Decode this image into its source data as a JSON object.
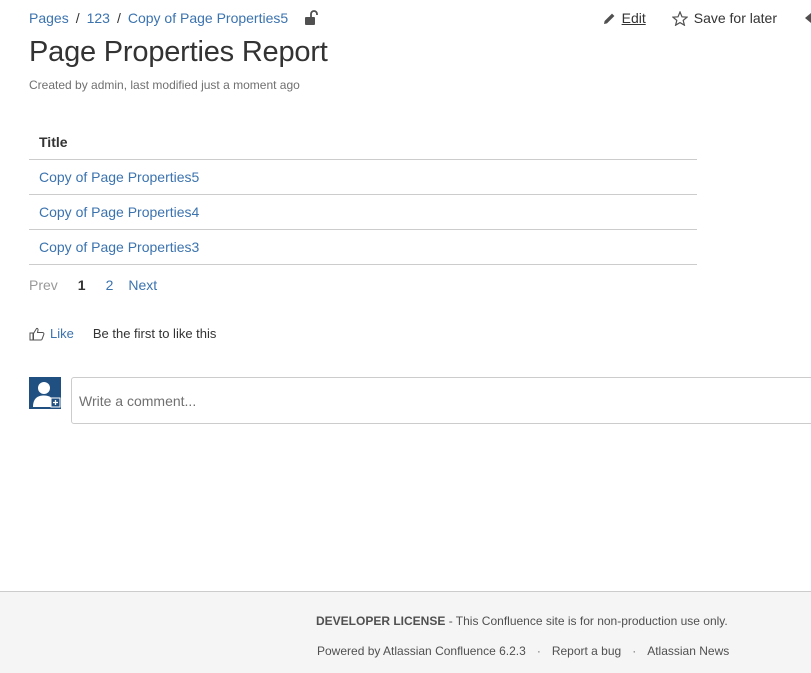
{
  "breadcrumb": {
    "items": [
      "Pages",
      "123",
      "Copy of Page Properties5"
    ],
    "separator": "/"
  },
  "actions": {
    "edit_label": "Edit",
    "save_label": "Save for later"
  },
  "page": {
    "title": "Page Properties Report",
    "byline": "Created by admin, last modified just a moment ago"
  },
  "report": {
    "header": "Title",
    "rows": [
      "Copy of Page Properties5",
      "Copy of Page Properties4",
      "Copy of Page Properties3"
    ]
  },
  "pagination": {
    "prev": "Prev",
    "current": "1",
    "page2": "2",
    "next": "Next"
  },
  "likes": {
    "like_label": "Like",
    "summary": "Be the first to like this"
  },
  "comment": {
    "placeholder": "Write a comment..."
  },
  "footer": {
    "license_bold": "DEVELOPER LICENSE",
    "license_text": " - This Confluence site is for non-production use only.",
    "powered_by": "Powered by Atlassian Confluence 6.2.3",
    "report_bug": "Report a bug",
    "news": "Atlassian News",
    "separator": "·"
  },
  "colors": {
    "link": "#3b73af",
    "avatar_bg": "#205081"
  }
}
